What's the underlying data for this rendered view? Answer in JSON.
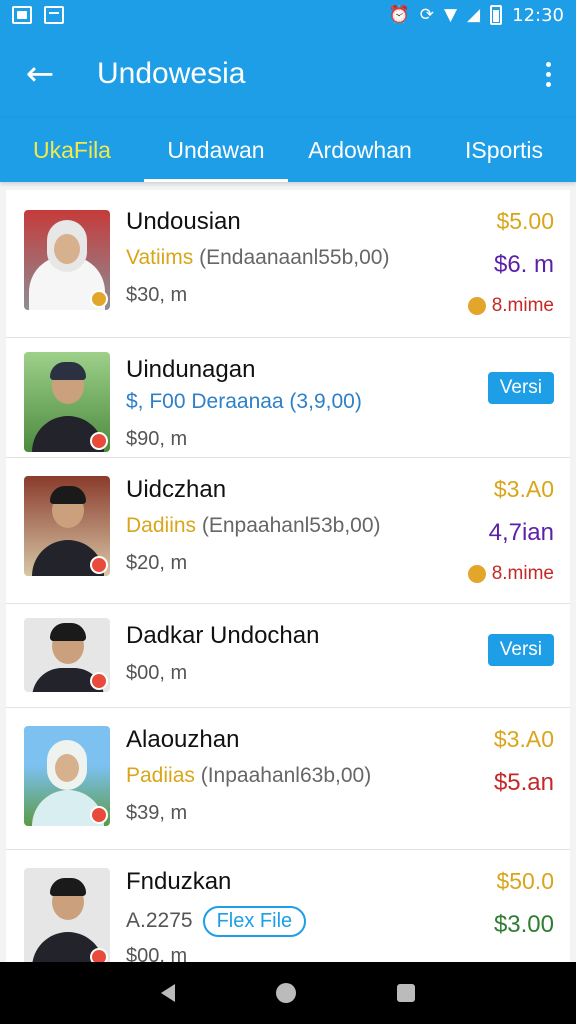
{
  "statusbar": {
    "time": "12:30"
  },
  "appbar": {
    "title": "Undowesia"
  },
  "tabs": [
    {
      "label": "UkaFila"
    },
    {
      "label": "Undawan"
    },
    {
      "label": "Ardowhan"
    },
    {
      "label": "ISportis"
    }
  ],
  "items": [
    {
      "name": "Undousian",
      "sub_highlight": "Vatiims",
      "sub_rest": " (Endaanaanl55b,00)",
      "meta": "$30, m",
      "price": "$5.00",
      "price2": "$6. m",
      "price2_color": "#5b1fa8",
      "tag": "8.mime"
    },
    {
      "name": "Uindunagan",
      "sub": "$, F00 Deraanaa (3,9,00)",
      "meta": "$90, m",
      "button": "Versi"
    },
    {
      "name": "Uidczhan",
      "sub_highlight": "Dadiins",
      "sub_rest": " (Enpaahanl53b,00)",
      "meta": "$20, m",
      "price": "$3.A0",
      "price2": "4,7ian",
      "price2_color": "#5b1fa8",
      "tag": "8.mime"
    },
    {
      "name": "Dadkar Undochan",
      "meta": "$00, m",
      "button": "Versi"
    },
    {
      "name": "Alaouzhan",
      "sub_highlight": "Padiias",
      "sub_rest": " (Inpaahanl63b,00)",
      "meta": "$39, m",
      "price": "$3.A0",
      "price2": "$5.an",
      "price2_color": "#c62828"
    },
    {
      "name": "Fnduzkan",
      "sub": "A.2275",
      "chip": "Flex File",
      "meta": "$00, m",
      "price": "$50.0",
      "price2": "$3.00",
      "price2_color": "#2e7d32"
    }
  ]
}
